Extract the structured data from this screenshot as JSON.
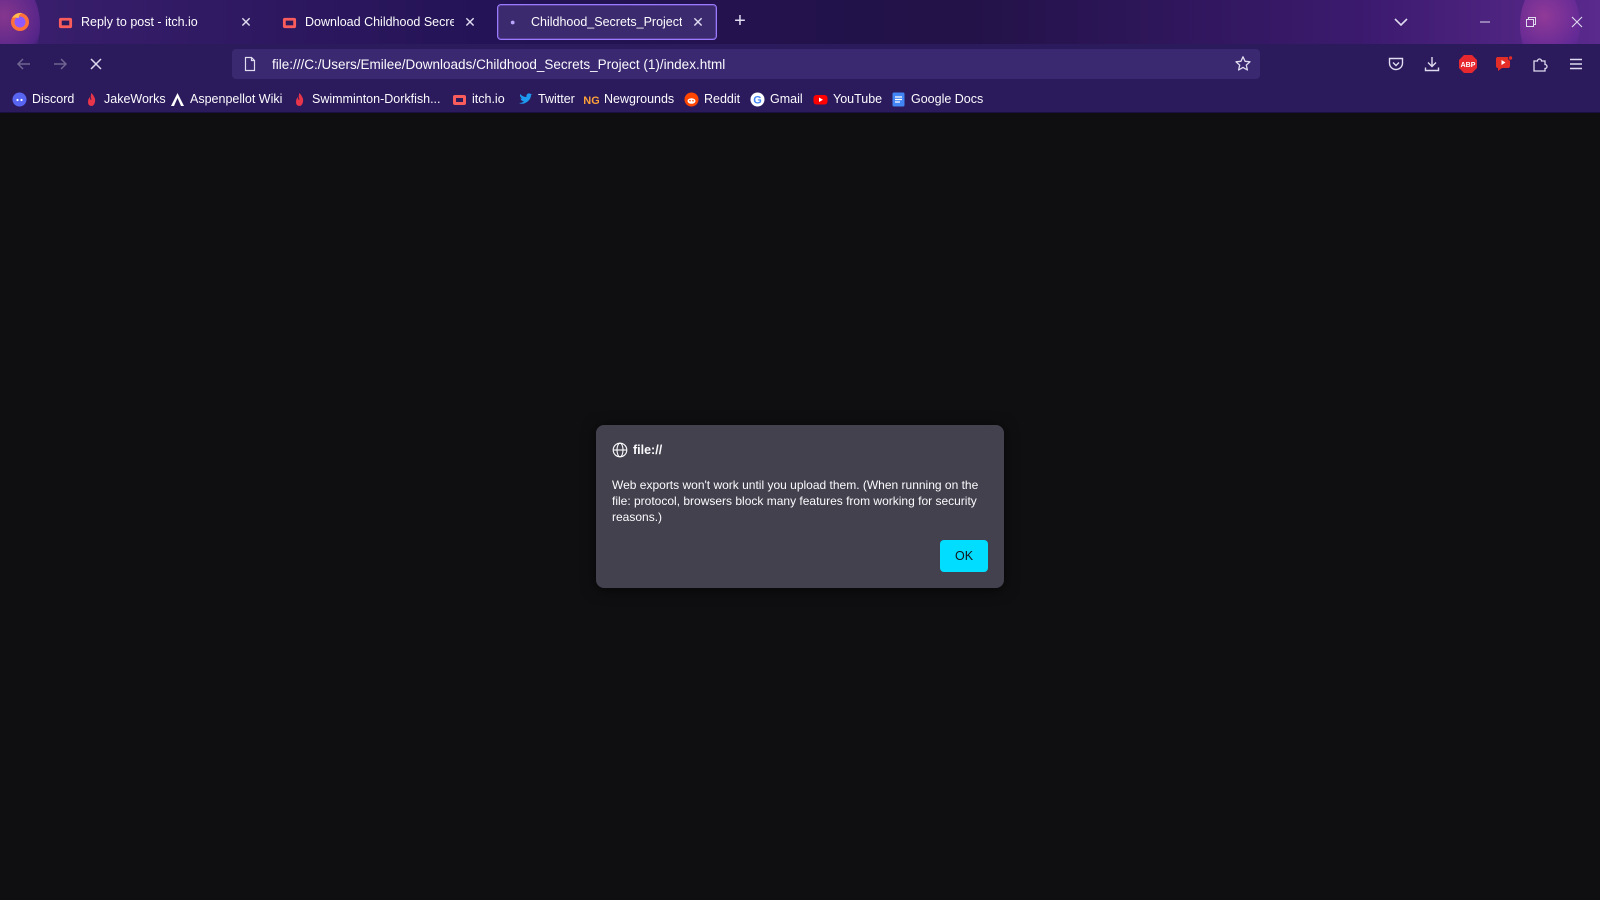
{
  "browser": {
    "tabs": [
      {
        "title": "Reply to post - itch.io",
        "favicon": "itchio-icon",
        "active": false
      },
      {
        "title": "Download Childhood Secrets by",
        "favicon": "itchio-icon",
        "active": false
      },
      {
        "title": "Childhood_Secrets_Project",
        "favicon": "loading-dot-icon",
        "active": true
      }
    ],
    "url": "file:///C:/Users/Emilee/Downloads/Childhood_Secrets_Project (1)/index.html",
    "bookmarks": [
      {
        "label": "Discord",
        "icon": "discord-icon"
      },
      {
        "label": "JakeWorks",
        "icon": "flame-icon"
      },
      {
        "label": "Aspenpellot Wiki",
        "icon": "wiki-a-icon"
      },
      {
        "label": "Swimminton-Dorkfish...",
        "icon": "flame-icon"
      },
      {
        "label": "itch.io",
        "icon": "itchio-icon"
      },
      {
        "label": "Twitter",
        "icon": "twitter-icon"
      },
      {
        "label": "Newgrounds",
        "icon": "newgrounds-icon"
      },
      {
        "label": "Reddit",
        "icon": "reddit-icon"
      },
      {
        "label": "Gmail",
        "icon": "google-icon"
      },
      {
        "label": "YouTube",
        "icon": "youtube-icon"
      },
      {
        "label": "Google Docs",
        "icon": "google-docs-icon"
      }
    ],
    "extensions": {
      "adblock_label": "ABP"
    }
  },
  "dialog": {
    "origin": "file://",
    "message": "Web exports won't work until you upload them. (When running on the file: protocol, browsers block many features from working for security reasons.)",
    "ok_label": "OK"
  },
  "colors": {
    "tabstrip": "#241356",
    "toolbar": "#2b1a5c",
    "content_bg": "#0f0f11",
    "dialog_bg": "#42414d",
    "accent": "#00ddff"
  }
}
